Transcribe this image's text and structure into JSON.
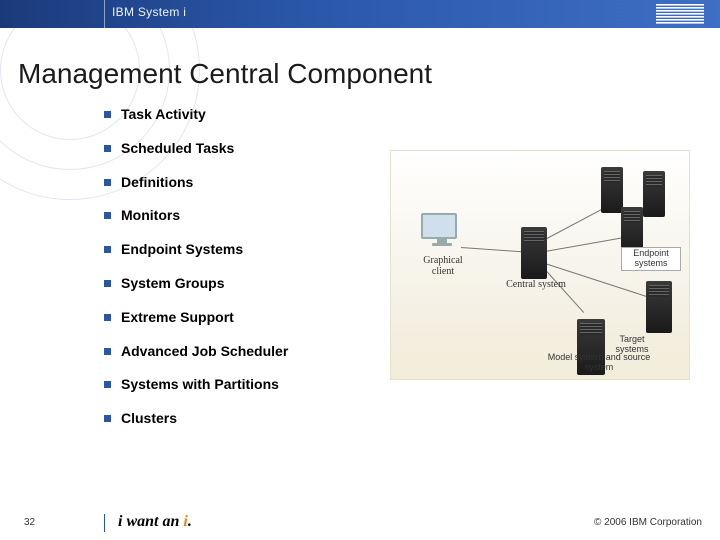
{
  "header": {
    "product": "IBM System i",
    "logo_alt": "IBM"
  },
  "title": "Management Central Component",
  "bullets": [
    "Task Activity",
    "Scheduled Tasks",
    "Definitions",
    "Monitors",
    "Endpoint Systems",
    "System Groups",
    "Extreme Support",
    "Advanced Job Scheduler",
    "Systems with Partitions",
    "Clusters"
  ],
  "diagram": {
    "graphical_client": "Graphical client",
    "central_system": "Central system",
    "endpoint_systems": "Endpoint systems",
    "target_systems": "Target systems",
    "model_source": "Model system and source system"
  },
  "footer": {
    "page": "32",
    "tagline_prefix": "i want an ",
    "tagline_accent": "i",
    "tagline_suffix": ".",
    "copyright": "© 2006 IBM Corporation"
  }
}
